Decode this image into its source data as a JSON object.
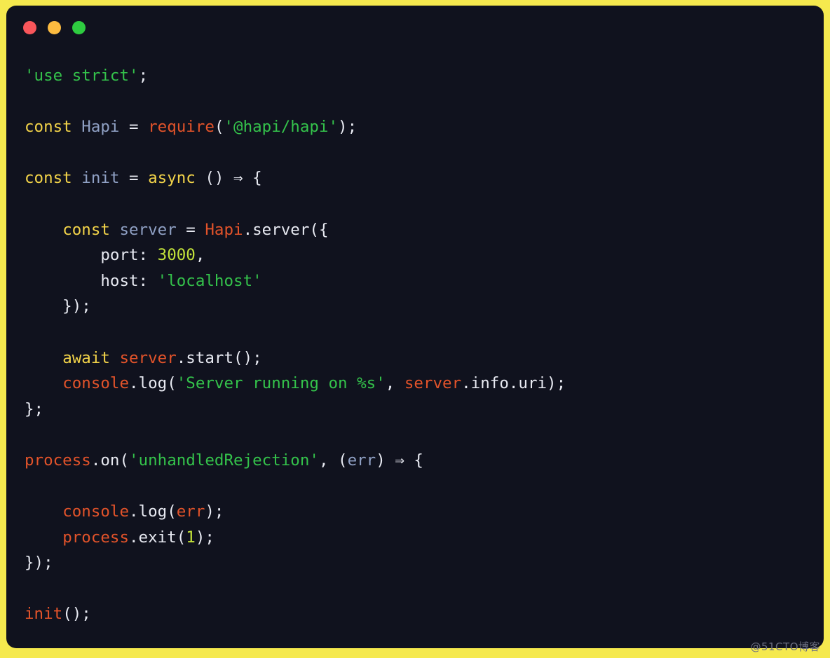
{
  "window": {
    "background_color": "#F5E94E",
    "panel_color": "#10121E",
    "controls": [
      {
        "name": "close",
        "color": "#F9565B"
      },
      {
        "name": "minimize",
        "color": "#FCBB40"
      },
      {
        "name": "maximize",
        "color": "#2ECC40"
      }
    ]
  },
  "watermark": {
    "text": "@51CTO博客"
  },
  "palette": {
    "keyword": "#F2D349",
    "variable": "#8FA0C4",
    "reference": "#E2532A",
    "string": "#34C24B",
    "number": "#C3E23A",
    "plain": "#E8EAF2"
  },
  "code": {
    "language": "javascript",
    "plain_text": "'use strict';\n\nconst Hapi = require('@hapi/hapi');\n\nconst init = async () ⇒ {\n\n    const server = Hapi.server({\n        port: 3000,\n        host: 'localhost'\n    });\n\n    await server.start();\n    console.log('Server running on %s', server.info.uri);\n};\n\nprocess.on('unhandledRejection', (err) ⇒ {\n\n    console.log(err);\n    process.exit(1);\n});\n\ninit();",
    "lines": [
      {
        "n": 1,
        "tokens": [
          {
            "t": "'use strict'",
            "c": "str"
          },
          {
            "t": ";",
            "c": "plain"
          }
        ]
      },
      {
        "n": 2,
        "tokens": []
      },
      {
        "n": 3,
        "tokens": [
          {
            "t": "const",
            "c": "kw"
          },
          {
            "t": " ",
            "c": "plain"
          },
          {
            "t": "Hapi",
            "c": "var"
          },
          {
            "t": " = ",
            "c": "plain"
          },
          {
            "t": "require",
            "c": "ref"
          },
          {
            "t": "(",
            "c": "plain"
          },
          {
            "t": "'@hapi/hapi'",
            "c": "str"
          },
          {
            "t": ");",
            "c": "plain"
          }
        ]
      },
      {
        "n": 4,
        "tokens": []
      },
      {
        "n": 5,
        "tokens": [
          {
            "t": "const",
            "c": "kw"
          },
          {
            "t": " ",
            "c": "plain"
          },
          {
            "t": "init",
            "c": "var"
          },
          {
            "t": " = ",
            "c": "plain"
          },
          {
            "t": "async",
            "c": "kw"
          },
          {
            "t": " () ⇒ {",
            "c": "plain"
          }
        ]
      },
      {
        "n": 6,
        "tokens": []
      },
      {
        "n": 7,
        "tokens": [
          {
            "t": "    ",
            "c": "plain"
          },
          {
            "t": "const",
            "c": "kw"
          },
          {
            "t": " ",
            "c": "plain"
          },
          {
            "t": "server",
            "c": "var"
          },
          {
            "t": " = ",
            "c": "plain"
          },
          {
            "t": "Hapi",
            "c": "ref"
          },
          {
            "t": ".server({",
            "c": "plain"
          }
        ]
      },
      {
        "n": 8,
        "tokens": [
          {
            "t": "        port: ",
            "c": "plain"
          },
          {
            "t": "3000",
            "c": "num"
          },
          {
            "t": ",",
            "c": "plain"
          }
        ]
      },
      {
        "n": 9,
        "tokens": [
          {
            "t": "        host: ",
            "c": "plain"
          },
          {
            "t": "'localhost'",
            "c": "str"
          }
        ]
      },
      {
        "n": 10,
        "tokens": [
          {
            "t": "    });",
            "c": "plain"
          }
        ]
      },
      {
        "n": 11,
        "tokens": []
      },
      {
        "n": 12,
        "tokens": [
          {
            "t": "    ",
            "c": "plain"
          },
          {
            "t": "await",
            "c": "kw"
          },
          {
            "t": " ",
            "c": "plain"
          },
          {
            "t": "server",
            "c": "ref"
          },
          {
            "t": ".start();",
            "c": "plain"
          }
        ]
      },
      {
        "n": 13,
        "tokens": [
          {
            "t": "    ",
            "c": "plain"
          },
          {
            "t": "console",
            "c": "ref"
          },
          {
            "t": ".log(",
            "c": "plain"
          },
          {
            "t": "'Server running on %s'",
            "c": "str"
          },
          {
            "t": ", ",
            "c": "plain"
          },
          {
            "t": "server",
            "c": "ref"
          },
          {
            "t": ".info.uri);",
            "c": "plain"
          }
        ]
      },
      {
        "n": 14,
        "tokens": [
          {
            "t": "};",
            "c": "plain"
          }
        ]
      },
      {
        "n": 15,
        "tokens": []
      },
      {
        "n": 16,
        "tokens": [
          {
            "t": "process",
            "c": "ref"
          },
          {
            "t": ".on(",
            "c": "plain"
          },
          {
            "t": "'unhandledRejection'",
            "c": "str"
          },
          {
            "t": ", (",
            "c": "plain"
          },
          {
            "t": "err",
            "c": "var"
          },
          {
            "t": ") ⇒ {",
            "c": "plain"
          }
        ]
      },
      {
        "n": 17,
        "tokens": []
      },
      {
        "n": 18,
        "tokens": [
          {
            "t": "    ",
            "c": "plain"
          },
          {
            "t": "console",
            "c": "ref"
          },
          {
            "t": ".log(",
            "c": "plain"
          },
          {
            "t": "err",
            "c": "ref"
          },
          {
            "t": ");",
            "c": "plain"
          }
        ]
      },
      {
        "n": 19,
        "tokens": [
          {
            "t": "    ",
            "c": "plain"
          },
          {
            "t": "process",
            "c": "ref"
          },
          {
            "t": ".exit(",
            "c": "plain"
          },
          {
            "t": "1",
            "c": "num"
          },
          {
            "t": ");",
            "c": "plain"
          }
        ]
      },
      {
        "n": 20,
        "tokens": [
          {
            "t": "});",
            "c": "plain"
          }
        ]
      },
      {
        "n": 21,
        "tokens": []
      },
      {
        "n": 22,
        "tokens": [
          {
            "t": "init",
            "c": "ref"
          },
          {
            "t": "();",
            "c": "plain"
          }
        ]
      }
    ]
  }
}
